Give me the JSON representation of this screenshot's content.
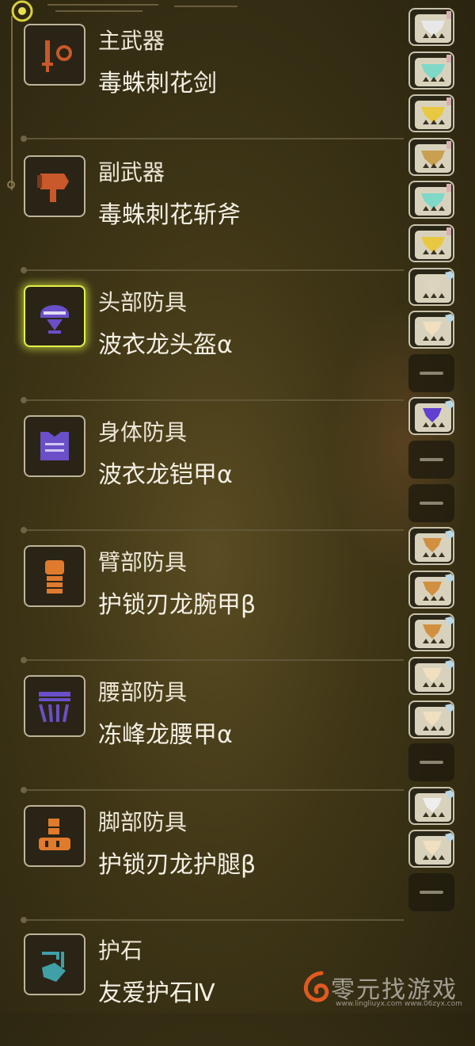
{
  "equipment": [
    {
      "slot_label": "主武器",
      "name": "毒蛛刺花剑",
      "icon": "sword-icon",
      "color": "#c9582a"
    },
    {
      "slot_label": "副武器",
      "name": "毒蛛刺花斩斧",
      "icon": "switch-axe-icon",
      "color": "#c9582a"
    },
    {
      "slot_label": "头部防具",
      "name": "波衣龙头盔α",
      "icon": "helmet-icon",
      "color": "#6a4fc8",
      "selected": true
    },
    {
      "slot_label": "身体防具",
      "name": "波衣龙铠甲α",
      "icon": "chest-armor-icon",
      "color": "#6a4fc8"
    },
    {
      "slot_label": "臂部防具",
      "name": "护锁刃龙腕甲β",
      "icon": "gauntlet-icon",
      "color": "#e07a2c"
    },
    {
      "slot_label": "腰部防具",
      "name": "冻峰龙腰甲α",
      "icon": "waist-armor-icon",
      "color": "#6a4fc8"
    },
    {
      "slot_label": "脚部防具",
      "name": "护锁刃龙护腿β",
      "icon": "leg-armor-icon",
      "color": "#e07a2c"
    },
    {
      "slot_label": "护石",
      "name": "友爱护石Ⅳ",
      "icon": "charm-icon",
      "color": "#3fa0a8"
    }
  ],
  "slots": [
    {
      "kind": "filled",
      "icon": "weapon-decoration-icon",
      "color": "#e8e8e8"
    },
    {
      "kind": "filled",
      "icon": "weapon-decoration-icon",
      "color": "#7fd8c8"
    },
    {
      "kind": "filled",
      "icon": "weapon-decoration-icon",
      "color": "#e8c840"
    },
    {
      "kind": "filled",
      "icon": "weapon-decoration-icon",
      "color": "#c8a050"
    },
    {
      "kind": "filled",
      "icon": "weapon-decoration-icon",
      "color": "#7fd8c8"
    },
    {
      "kind": "filled",
      "icon": "weapon-decoration-icon",
      "color": "#e8c840"
    },
    {
      "kind": "filled",
      "icon": "armor-decoration-icon",
      "color": "#ddd4c0"
    },
    {
      "kind": "filled",
      "icon": "armor-decoration-icon",
      "color": "#f0e0c0"
    },
    {
      "kind": "empty",
      "icon": "empty-slot-icon"
    },
    {
      "kind": "filled",
      "icon": "armor-decoration-icon",
      "color": "#6040d0"
    },
    {
      "kind": "empty",
      "icon": "empty-slot-icon"
    },
    {
      "kind": "empty",
      "icon": "empty-slot-icon"
    },
    {
      "kind": "filled",
      "icon": "armor-decoration-icon",
      "color": "#d09040"
    },
    {
      "kind": "filled",
      "icon": "armor-decoration-icon",
      "color": "#d09040"
    },
    {
      "kind": "filled",
      "icon": "armor-decoration-icon",
      "color": "#d09040"
    },
    {
      "kind": "filled",
      "icon": "armor-decoration-icon",
      "color": "#f0e0c0"
    },
    {
      "kind": "filled",
      "icon": "armor-decoration-icon",
      "color": "#f0e0c0"
    },
    {
      "kind": "empty",
      "icon": "empty-slot-icon"
    },
    {
      "kind": "filled",
      "icon": "armor-decoration-icon",
      "color": "#eeeeee"
    },
    {
      "kind": "filled",
      "icon": "armor-decoration-icon",
      "color": "#f0e0c0"
    },
    {
      "kind": "empty",
      "icon": "empty-slot-icon"
    }
  ],
  "watermark": {
    "text": "零元找游戏",
    "url_text": "www.lingliuyx.com  www.06zyx.com"
  }
}
